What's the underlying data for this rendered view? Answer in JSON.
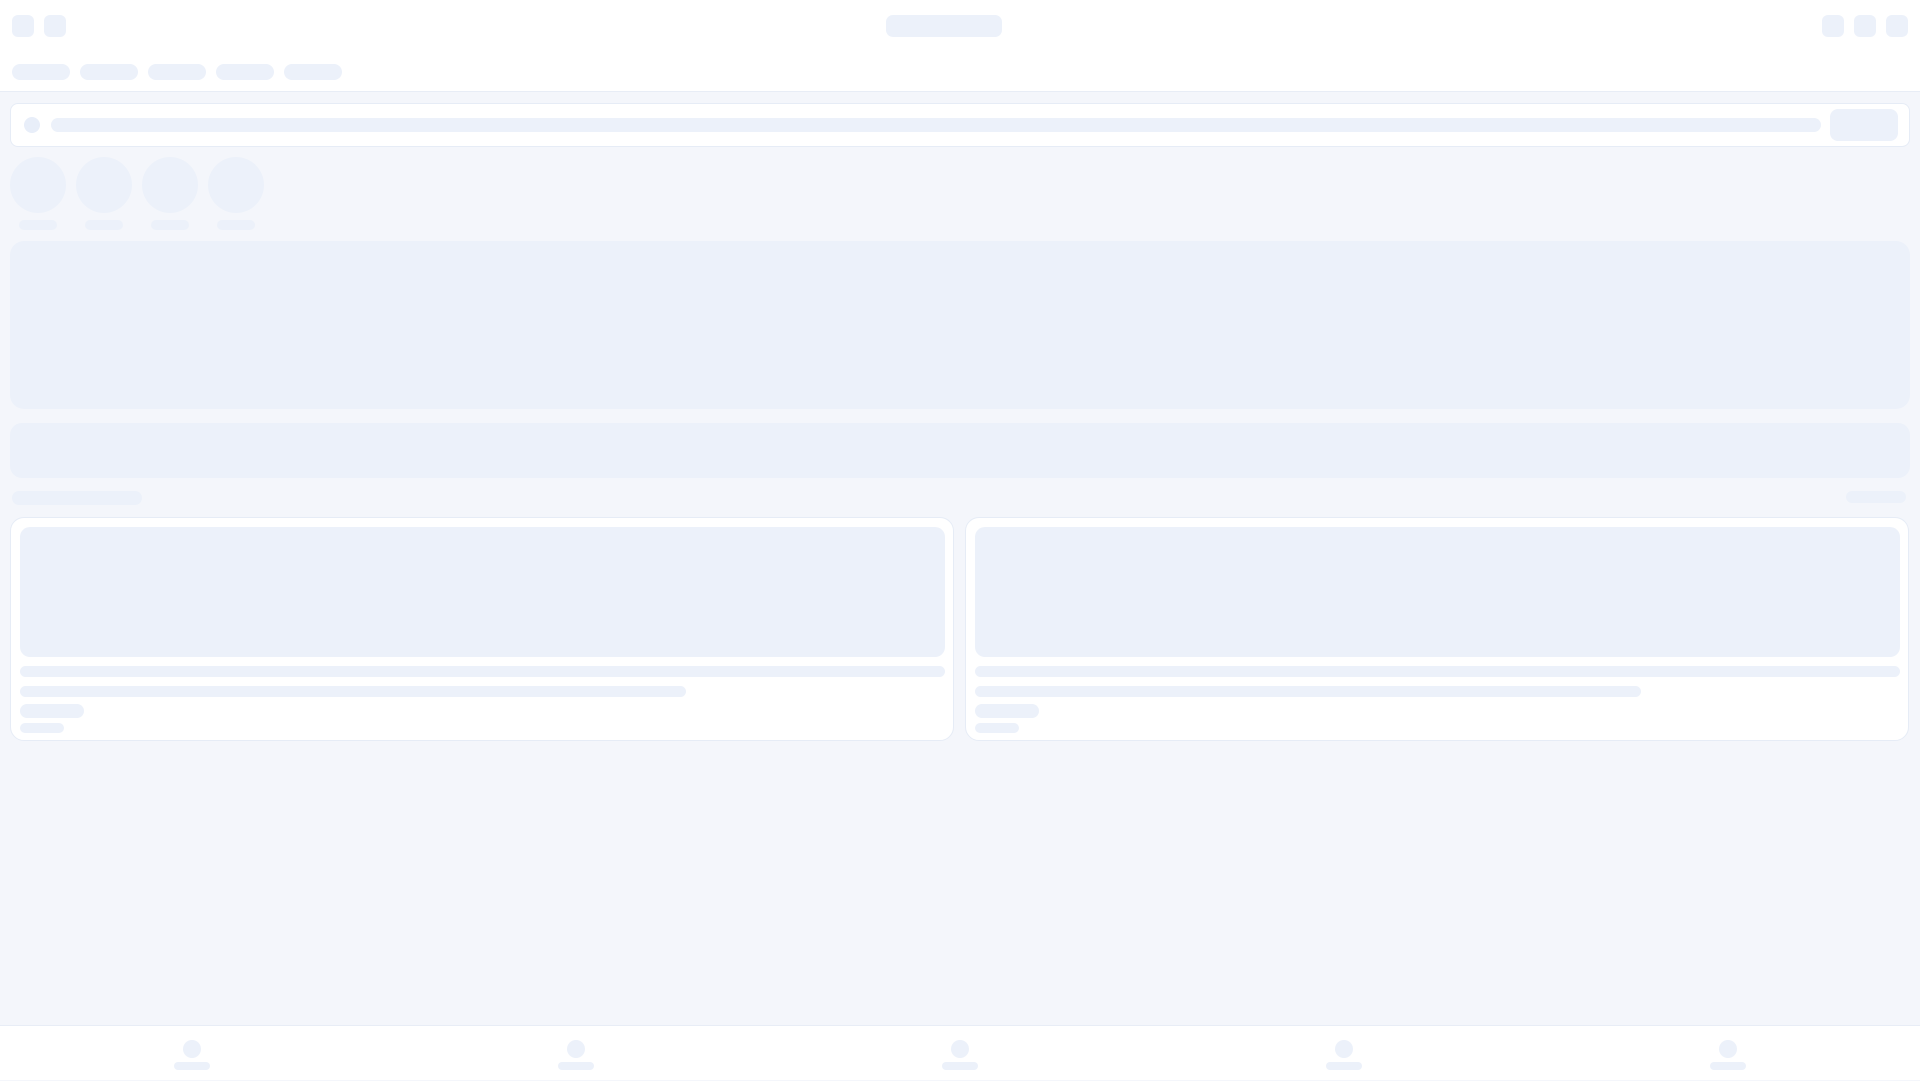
{
  "header": {
    "title": "",
    "left_buttons": [
      {
        "icon": "menu-icon"
      },
      {
        "icon": "back-icon"
      }
    ],
    "right_buttons": [
      {
        "icon": "search-icon"
      },
      {
        "icon": "bell-icon"
      },
      {
        "icon": "profile-icon"
      }
    ]
  },
  "tabs": [
    {
      "label": ""
    },
    {
      "label": ""
    },
    {
      "label": ""
    },
    {
      "label": ""
    },
    {
      "label": ""
    }
  ],
  "search": {
    "placeholder": "",
    "value": "",
    "button_label": ""
  },
  "stories": [
    {
      "label": ""
    },
    {
      "label": ""
    },
    {
      "label": ""
    },
    {
      "label": ""
    }
  ],
  "section": {
    "title": "",
    "see_all_label": ""
  },
  "cards": [
    {
      "title": "",
      "subtitle": "",
      "tag": "",
      "meta": ""
    },
    {
      "title": "",
      "subtitle": "",
      "tag": "",
      "meta": ""
    }
  ],
  "bottom_nav": [
    {
      "label": "",
      "icon": "home-icon"
    },
    {
      "label": "",
      "icon": "explore-icon"
    },
    {
      "label": "",
      "icon": "add-icon"
    },
    {
      "label": "",
      "icon": "messages-icon"
    },
    {
      "label": "",
      "icon": "account-icon"
    }
  ],
  "state": "loading-skeleton",
  "colors": {
    "background": "#f4f6fb",
    "surface": "#ffffff",
    "skeleton": "#ecf1fa",
    "border": "#e6ecf6"
  }
}
